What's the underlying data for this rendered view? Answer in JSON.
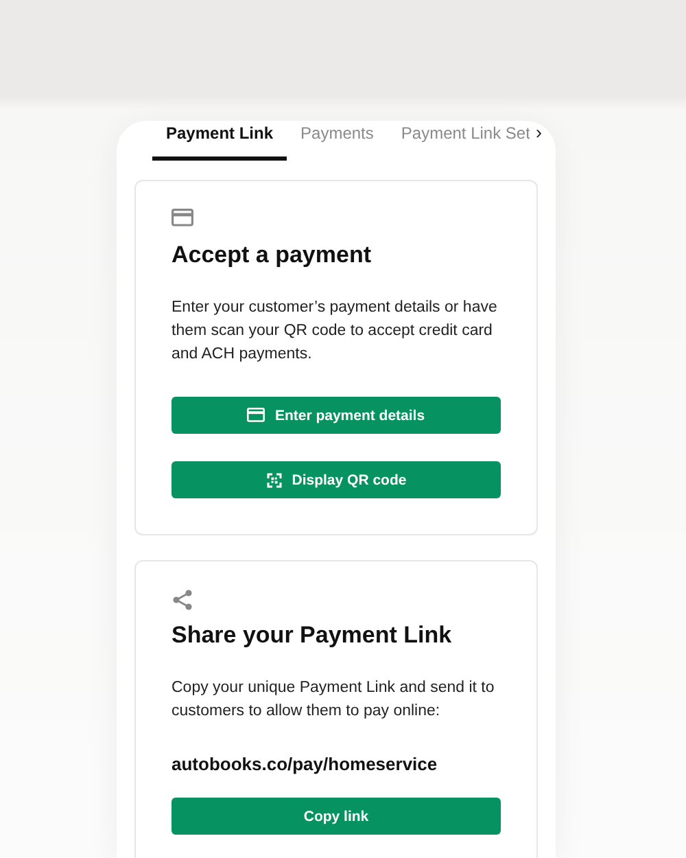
{
  "tabs": [
    {
      "label": "Payment Link",
      "selected": true
    },
    {
      "label": "Payments",
      "selected": false
    },
    {
      "label": "Payment Link Set",
      "selected": false
    }
  ],
  "tabs_more": "›",
  "cards": [
    {
      "kind": "card",
      "title": "Accept a payment",
      "text": "Enter your customer’s payment details or have them scan your QR code to accept credit card and ACH payments.",
      "buttons": [
        {
          "label": "Enter payment details",
          "kind": "card"
        },
        {
          "label": "Display QR code",
          "kind": "qr"
        }
      ]
    },
    {
      "kind": "share",
      "title": "Share your Payment Link",
      "text": "Copy your unique Payment Link and send it to customers to allow them to pay online:",
      "link": "autobooks.co/pay/homeservice",
      "buttons": [
        {
          "label": "Copy link",
          "kind": "plain"
        }
      ]
    }
  ]
}
